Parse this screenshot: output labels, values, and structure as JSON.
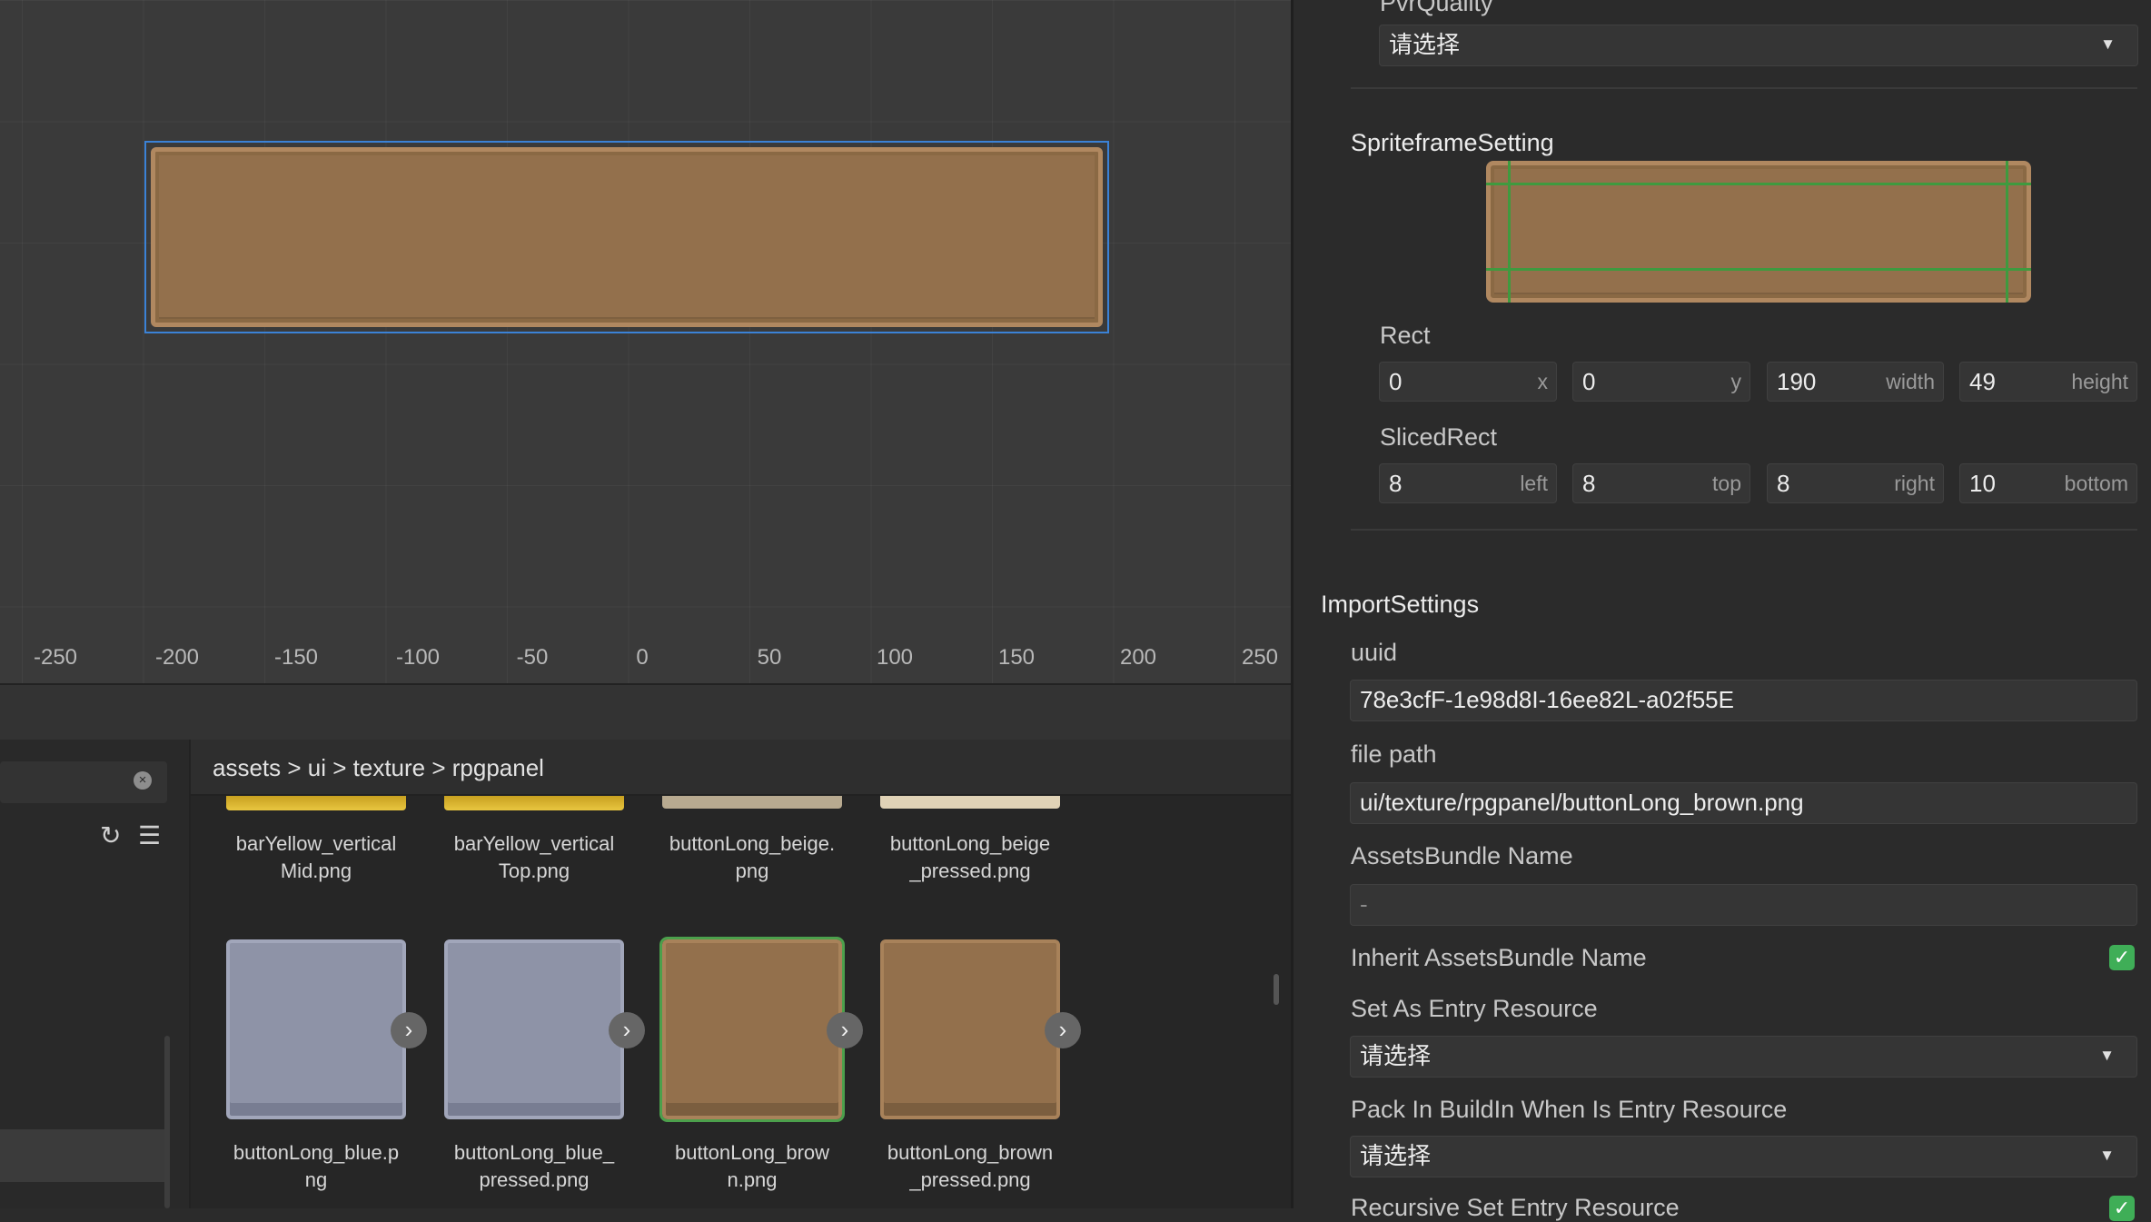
{
  "scene": {
    "ruler_labels": [
      "-250",
      "-200",
      "-150",
      "-100",
      "-50",
      "0",
      "50",
      "100",
      "150",
      "200",
      "250"
    ]
  },
  "assets": {
    "breadcrumb": "assets > ui > texture > rpgpanel",
    "files": [
      {
        "name": "barYellow_verticalMid.png",
        "line1": "barYellow_vertical",
        "line2": "Mid.png"
      },
      {
        "name": "barYellow_verticalTop.png",
        "line1": "barYellow_vertical",
        "line2": "Top.png"
      },
      {
        "name": "buttonLong_beige.png",
        "line1": "buttonLong_beige.",
        "line2": "png"
      },
      {
        "name": "buttonLong_beige_pressed.png",
        "line1": "buttonLong_beige",
        "line2": "_pressed.png"
      },
      {
        "name": "buttonLong_blue.png",
        "line1": "buttonLong_blue.p",
        "line2": "ng"
      },
      {
        "name": "buttonLong_blue_pressed.png",
        "line1": "buttonLong_blue_",
        "line2": "pressed.png"
      },
      {
        "name": "buttonLong_brown.png",
        "line1": "buttonLong_brow",
        "line2": "n.png"
      },
      {
        "name": "buttonLong_brown_pressed.png",
        "line1": "buttonLong_brown",
        "line2": "_pressed.png"
      }
    ],
    "icons": {
      "refresh": "refresh-icon",
      "menu": "menu-icon",
      "clear": "clear-search-icon",
      "expand": "chevron-right-icon"
    }
  },
  "inspector": {
    "pvr_quality_label": "PvrQuality",
    "pvr_quality_value": "请选择",
    "spriteframe_setting_label": "SpriteframeSetting",
    "rect_label": "Rect",
    "rect": {
      "x": "0",
      "x_label": "x",
      "y": "0",
      "y_label": "y",
      "width": "190",
      "width_label": "width",
      "height": "49",
      "height_label": "height"
    },
    "sliced_rect_label": "SlicedRect",
    "sliced": {
      "left": "8",
      "left_label": "left",
      "top": "8",
      "top_label": "top",
      "right": "8",
      "right_label": "right",
      "bottom": "10",
      "bottom_label": "bottom"
    },
    "import_settings_label": "ImportSettings",
    "uuid_label": "uuid",
    "uuid_value": "78e3cfF-1e98d8I-16ee82L-a02f55E",
    "file_path_label": "file path",
    "file_path_value": "ui/texture/rpgpanel/buttonLong_brown.png",
    "assets_bundle_name_label": "AssetsBundle Name",
    "assets_bundle_name_value": "-",
    "inherit_bundle_label": "Inherit AssetsBundle Name",
    "inherit_bundle_checked": true,
    "set_entry_label": "Set As Entry Resource",
    "set_entry_value": "请选择",
    "pack_buildin_label": "Pack In BuildIn When Is Entry Resource",
    "pack_buildin_value": "请选择",
    "recursive_label": "Recursive Set Entry Resource",
    "check_glyph": "✓",
    "caret_glyph": "▼"
  },
  "colors": {
    "selection_blue": "#3b82d6",
    "slice_green": "#3f9a3f",
    "checkbox_green": "#3fae57",
    "wood_brown": "#93704c",
    "blue_grey": "#8e93a7"
  }
}
